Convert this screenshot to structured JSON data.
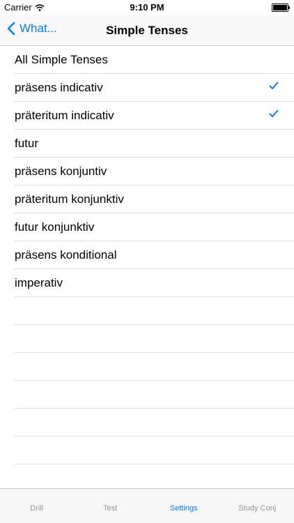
{
  "status_bar": {
    "carrier": "Carrier",
    "time": "9:10 PM"
  },
  "nav": {
    "back_label": "What...",
    "title": "Simple Tenses"
  },
  "colors": {
    "accent": "#0a7bf5"
  },
  "list": {
    "items": [
      {
        "label": "All Simple Tenses",
        "checked": false
      },
      {
        "label": "präsens indicativ",
        "checked": true
      },
      {
        "label": "präteritum indicativ",
        "checked": true
      },
      {
        "label": "futur",
        "checked": false
      },
      {
        "label": "präsens konjuntiv",
        "checked": false
      },
      {
        "label": "präteritum konjunktiv",
        "checked": false
      },
      {
        "label": "futur konjunktiv",
        "checked": false
      },
      {
        "label": "präsens konditional",
        "checked": false
      },
      {
        "label": "imperativ",
        "checked": false
      }
    ]
  },
  "tabs": [
    {
      "label": "Drill",
      "active": false
    },
    {
      "label": "Test",
      "active": false
    },
    {
      "label": "Settings",
      "active": true
    },
    {
      "label": "Study Conj",
      "active": false
    }
  ]
}
